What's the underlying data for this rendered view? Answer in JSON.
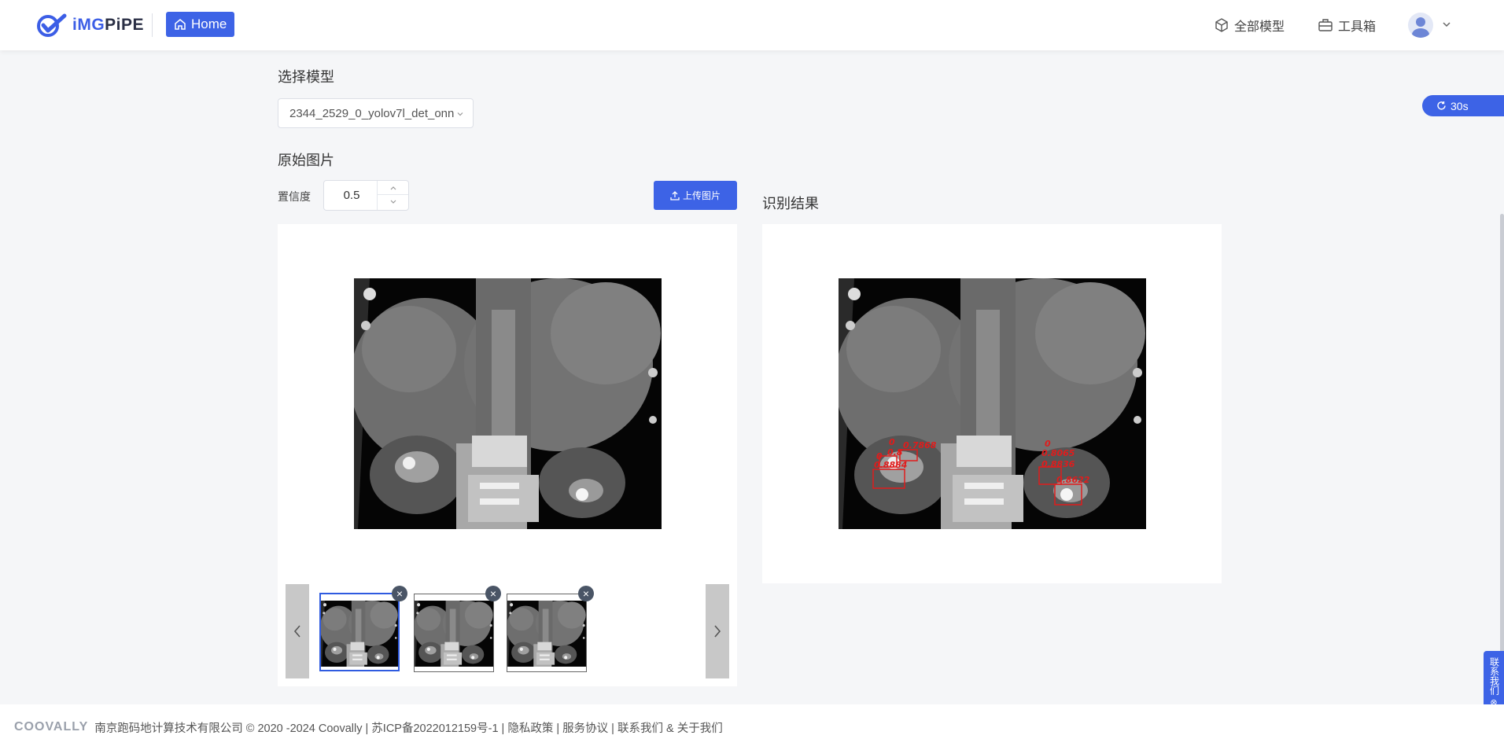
{
  "header": {
    "logo_text_prefix": "iMG",
    "logo_text_suffix": "PiPE",
    "home_label": "Home",
    "nav": [
      {
        "label": "全部模型",
        "icon": "cube-icon"
      },
      {
        "label": "工具箱",
        "icon": "toolbox-icon"
      }
    ],
    "avatar_icon": "user-avatar-icon"
  },
  "model_section": {
    "title": "选择模型",
    "selected_model": "2344_2529_0_yolov7l_det_onn"
  },
  "original_section": {
    "title": "原始图片",
    "confidence_label": "置信度",
    "confidence_value": "0.5",
    "upload_label": "上传图片"
  },
  "result_section": {
    "title": "识别结果",
    "detections": [
      {
        "label": "0.8884"
      },
      {
        "label": "0.8"
      },
      {
        "label": "0.7868"
      },
      {
        "label": "0"
      },
      {
        "label": "0"
      },
      {
        "label": "0.8065"
      },
      {
        "label": "0.8836"
      },
      {
        "label": "0.8622"
      },
      {
        "label": "0"
      }
    ]
  },
  "thumbnails": {
    "count": 3,
    "active_index": 0,
    "close_glyph": "×"
  },
  "refresh_timer": "30s",
  "contact_tab": "联系我们",
  "footer": {
    "brand": "COOVALLY",
    "text": "南京跑码地计算技术有限公司 © 2020 -2024 Coovally | 苏ICP备2022012159号-1 | 隐私政策 | 服务协议 | 联系我们 & 关于我们"
  },
  "colors": {
    "primary": "#3d63e6",
    "detection_box": "#e01c1c",
    "page_bg": "#f5f6f8"
  }
}
